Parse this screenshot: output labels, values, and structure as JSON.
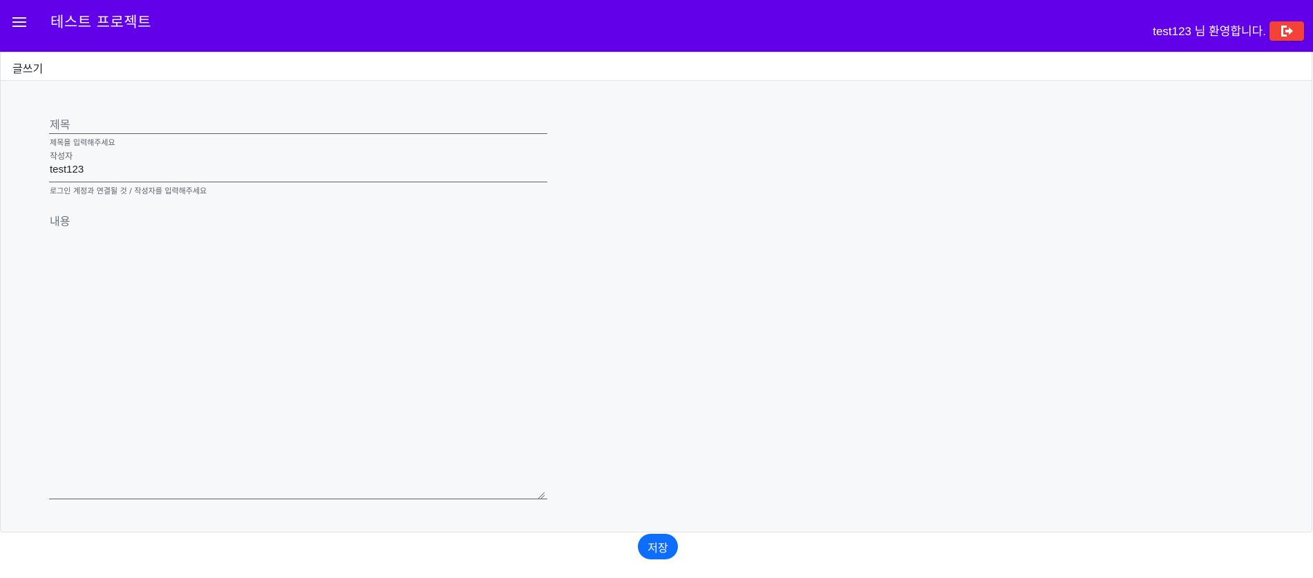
{
  "appbar": {
    "title": "테스트 프로젝트",
    "welcome_text": "test123 님 환영합니다.",
    "menu_icon": "hamburger-menu-icon",
    "logout_icon": "sign-out-icon",
    "background_color": "#6200ea",
    "logout_color": "#f44336"
  },
  "card": {
    "title": "글쓰기"
  },
  "form": {
    "title_field": {
      "placeholder": "제목",
      "hint": "제목을 입력해주세요"
    },
    "author_field": {
      "label": "작성자",
      "value": "test123",
      "hint": "로그인 계정과 연결될 것 / 작성자를 입력해주세요"
    },
    "content_field": {
      "placeholder": "내용"
    }
  },
  "actions": {
    "save_label": "저장",
    "save_color": "#0d6efd"
  }
}
